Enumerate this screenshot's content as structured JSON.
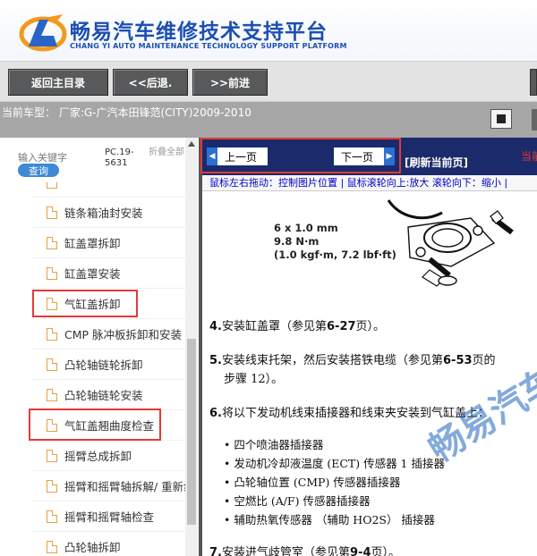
{
  "header": {
    "brand_cn": "畅易汽车维修技术支持平台",
    "brand_en": "CHANG YI AUTO MAINTENANCE TECHNOLOGY SUPPORT PLATFORM"
  },
  "nav": {
    "back_to_main": "返回主目录",
    "back": "<<后退.",
    "forward": ">>前进"
  },
  "vehicle": {
    "text": "当前车型： 厂家:G-广汽本田锋范(CITY)2009-2010"
  },
  "sidebar": {
    "search_label": "输入关键字",
    "search_button": "查询",
    "doc_code": "PC.19-5631",
    "collapse": "折叠全部",
    "items": [
      {
        "label": "链条箱油封安装"
      },
      {
        "label": "缸盖罩拆卸"
      },
      {
        "label": "缸盖罩安装"
      },
      {
        "label": "气缸盖拆卸"
      },
      {
        "label": "CMP 脉冲板拆卸和安装"
      },
      {
        "label": "凸轮轴链轮拆卸"
      },
      {
        "label": "凸轮轴链轮安装"
      },
      {
        "label": "气缸盖翘曲度检查"
      },
      {
        "label": "摇臂总成拆卸"
      },
      {
        "label": "摇臂和摇臂轴拆解/ 重新组装"
      },
      {
        "label": "摇臂和摇臂轴检查"
      },
      {
        "label": "凸轮轴拆卸"
      }
    ]
  },
  "viewer": {
    "prev_page": "上一页",
    "next_page": "下一页",
    "refresh": "[刷新当前页]",
    "current": "当前",
    "hint": "鼠标左右拖动：控制图片位置 | 鼠标滚轮向上:放大  滚轮向下：缩小 |",
    "spec": [
      "6 x 1.0 mm",
      "9.8 N·m",
      "(1.0 kgf·m, 7.2 lbf·ft)"
    ],
    "step4": {
      "num": "4.",
      "text": "安装缸盖罩（参见第",
      "ref": "6-27",
      "tail": "页）。"
    },
    "step5": {
      "num": "5.",
      "text": "安装线束托架，然后安装搭铁电缆（参见第",
      "ref": "6-53",
      "tail": "页的",
      "line2": "步骤 12）。"
    },
    "step6": {
      "num": "6.",
      "text": "将以下发动机线束插接器和线束夹安装到气缸盖上："
    },
    "bullets": [
      "• 四个喷油器插接器",
      "• 发动机冷却液温度 (ECT) 传感器 1 插接器",
      "• 凸轮轴位置 (CMP) 传感器插接器",
      "• 空燃比 (A/F) 传感器插接器",
      "• 辅助热氧传感器 （辅助 HO2S） 插接器"
    ],
    "step7": {
      "num": "7.",
      "text": "安装进气歧管室（参见第",
      "ref": "9-4",
      "tail": "页）。"
    },
    "watermark": "畅易汽车"
  },
  "colors": {
    "brand_blue": "#1c4fb3",
    "toolbar": "#1b2a6b",
    "highlight": "#e53935",
    "icon_orange": "#e8a040"
  }
}
